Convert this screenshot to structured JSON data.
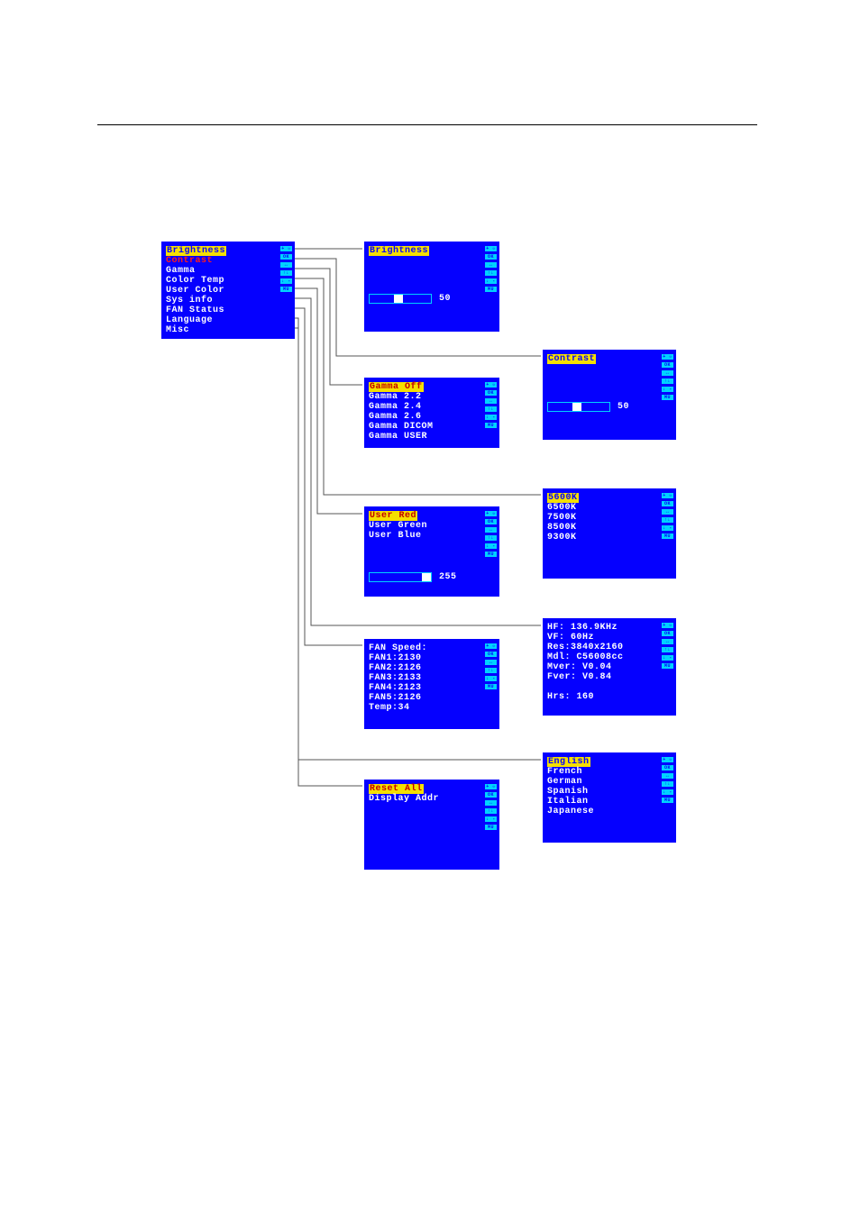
{
  "main_menu": {
    "items": [
      {
        "label": "Brightness",
        "style": "hl"
      },
      {
        "label": "Contrast",
        "style": "red"
      },
      {
        "label": "Gamma",
        "style": "white"
      },
      {
        "label": "Color Temp",
        "style": "white"
      },
      {
        "label": "User Color",
        "style": "white"
      },
      {
        "label": "Sys info",
        "style": "white"
      },
      {
        "label": "FAN Status",
        "style": "white"
      },
      {
        "label": "Language",
        "style": "white"
      },
      {
        "label": "Misc",
        "style": "white"
      }
    ]
  },
  "brightness_panel": {
    "title": "Brightness",
    "value": "50",
    "thumb_pct": 40
  },
  "contrast_panel": {
    "title": "Contrast",
    "value": "50",
    "thumb_pct": 40
  },
  "gamma_panel": {
    "items": [
      {
        "label": "Gamma Off",
        "style": "hlred"
      },
      {
        "label": "Gamma 2.2"
      },
      {
        "label": "Gamma 2.4"
      },
      {
        "label": "Gamma 2.6"
      },
      {
        "label": "Gamma DICOM"
      },
      {
        "label": "Gamma USER"
      }
    ]
  },
  "color_temp_panel": {
    "items": [
      {
        "label": "5600K",
        "style": "hl"
      },
      {
        "label": "6500K"
      },
      {
        "label": "7500K"
      },
      {
        "label": "8500K"
      },
      {
        "label": "9300K"
      }
    ]
  },
  "user_color_panel": {
    "items": [
      {
        "label": "User Red",
        "style": "hlred"
      },
      {
        "label": "User Green"
      },
      {
        "label": "User Blue"
      }
    ],
    "value": "255",
    "thumb_pct": 86
  },
  "sys_info_panel": {
    "lines": [
      "HF: 136.9KHz",
      "VF: 60Hz",
      "Res:3840x2160",
      "Mdl: C56008cc",
      "Mver: V0.04",
      "Fver: V0.84",
      "",
      "Hrs: 160"
    ]
  },
  "fan_panel": {
    "lines": [
      "FAN Speed:",
      "FAN1:2130",
      "FAN2:2126",
      "FAN3:2133",
      "FAN4:2123",
      "FAN5:2126",
      "Temp:34"
    ]
  },
  "language_panel": {
    "items": [
      {
        "label": "English",
        "style": "hl"
      },
      {
        "label": "French"
      },
      {
        "label": "German"
      },
      {
        "label": "Spanish"
      },
      {
        "label": "Italian"
      },
      {
        "label": "Japanese"
      }
    ]
  },
  "misc_panel": {
    "items": [
      {
        "label": "Reset All",
        "style": "hlred"
      },
      {
        "label": "Display Addr"
      }
    ]
  },
  "icons": [
    "+ ☼",
    "OK",
    "↔",
    "↑↓",
    "↓ -",
    "MU"
  ]
}
